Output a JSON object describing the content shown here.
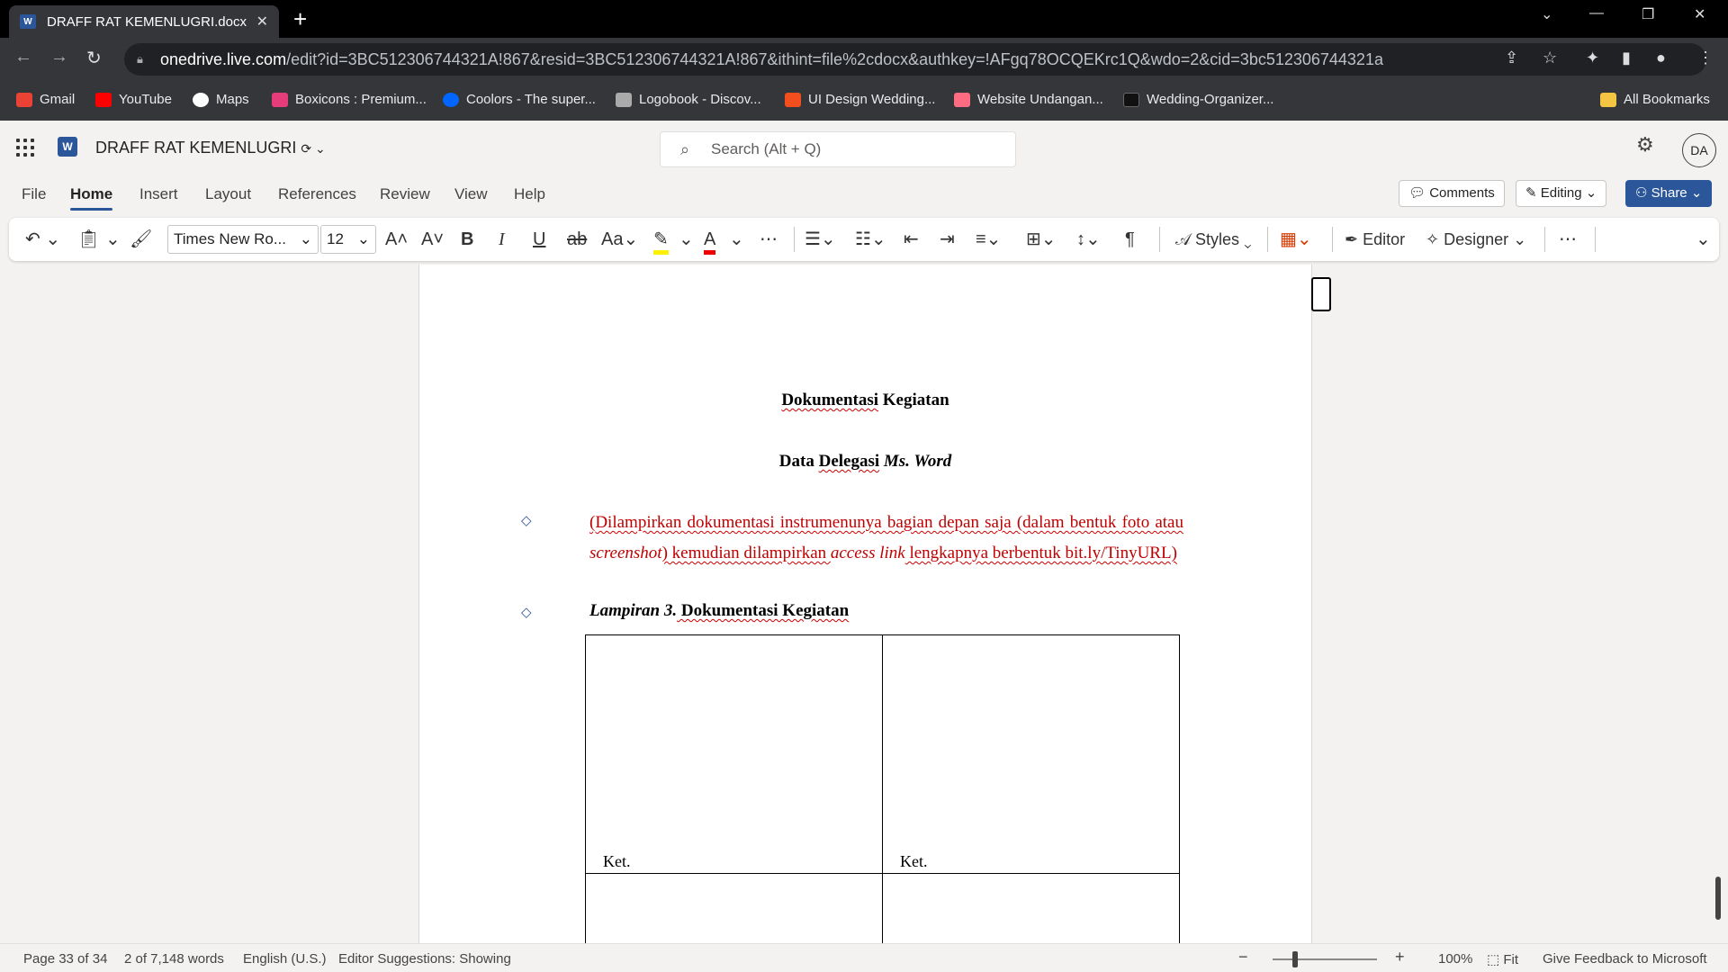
{
  "browser": {
    "tab_title": "DRAFF RAT KEMENLUGRI.docx -",
    "tab_icon": "word-icon",
    "new_tab": "+",
    "url_host": "onedrive.live.com",
    "url_path": "/edit?id=3BC512306744321A!867&resid=3BC512306744321A!867&ithint=file%2cdocx&authkey=!AFgq78OCQEKrc1Q&wdo=2&cid=3bc512306744321a",
    "bookmarks": [
      {
        "label": "Gmail",
        "icon": "gmail-icon",
        "color": "#ea4335"
      },
      {
        "label": "YouTube",
        "icon": "youtube-icon",
        "color": "#ff0000"
      },
      {
        "label": "Maps",
        "icon": "google-icon",
        "color": "#ffffff"
      },
      {
        "label": "Boxicons : Premium...",
        "icon": "boxicons-icon",
        "color": "#e63c7a"
      },
      {
        "label": "Coolors - The super...",
        "icon": "coolors-icon",
        "color": "#0066ff"
      },
      {
        "label": "Logobook - Discov...",
        "icon": "logobook-icon",
        "color": "#cccccc"
      },
      {
        "label": "UI Design Wedding...",
        "icon": "figma-icon",
        "color": "#f24e1e"
      },
      {
        "label": "Website Undangan...",
        "icon": "heart-icon",
        "color": "#ff6b81"
      },
      {
        "label": "Wedding-Organizer...",
        "icon": "github-icon",
        "color": "#000000"
      }
    ],
    "all_bookmarks": "All Bookmarks"
  },
  "word": {
    "doc_title": "DRAFF RAT KEMENLUGRI",
    "search_placeholder": "Search (Alt + Q)",
    "avatar_initials": "DA",
    "tabs": [
      "File",
      "Home",
      "Insert",
      "Layout",
      "References",
      "Review",
      "View",
      "Help"
    ],
    "active_tab": "Home",
    "comments_label": "Comments",
    "editing_label": "Editing",
    "share_label": "Share",
    "font_name": "Times New Ro...",
    "font_size": "12",
    "styles_label": "Styles",
    "editor_label": "Editor",
    "designer_label": "Designer"
  },
  "document": {
    "heading1_a": "Dokumentasi",
    "heading1_b": " Kegiatan",
    "heading2_a": "Data ",
    "heading2_b": "Delegasi",
    "heading2_c": " Ms. Word",
    "red_paragraph_1": "(Dilampirkan dokumentasi instrumenunya bagian depan saja (dalam bentuk foto atau ",
    "red_paragraph_italic": "screenshot",
    "red_paragraph_2": ") kemudian dilampirkan ",
    "red_paragraph_italic2": "access link",
    "red_paragraph_3": " lengkapnya berbentuk bit.ly/TinyURL)",
    "lampiran_a": "Lampiran 3.",
    "lampiran_b": " Dokumentasi Kegiatan",
    "table_cells": [
      "Ket.",
      "Ket."
    ]
  },
  "status": {
    "page": "Page 33 of 34",
    "words": "2 of 7,148 words",
    "language": "English (U.S.)",
    "editor_suggestions": "Editor Suggestions: Showing",
    "zoom_percent": "100%",
    "fit": "Fit",
    "feedback": "Give Feedback to Microsoft"
  }
}
